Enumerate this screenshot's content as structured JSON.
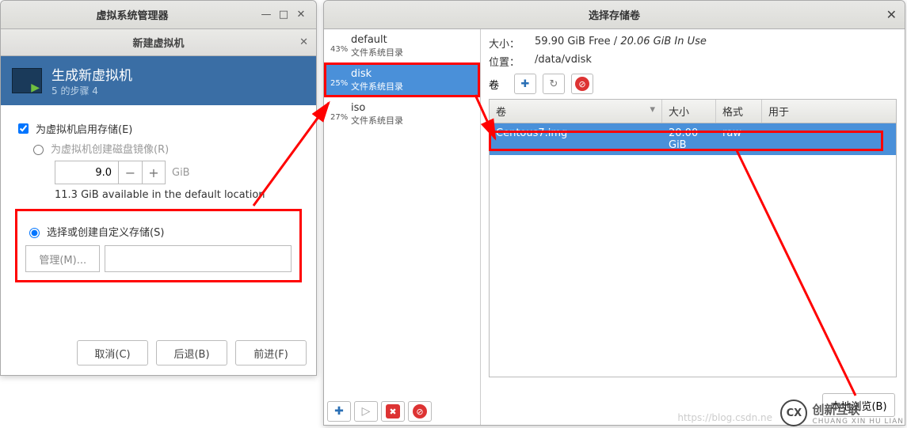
{
  "left_window": {
    "title": "虚拟系统管理器",
    "sub_title": "新建虚拟机",
    "banner_title": "生成新虚拟机",
    "banner_step": "5 的步骤 4",
    "enable_storage": "为虚拟机启用存储(E)",
    "create_disk": "为虚拟机创建磁盘镜像(R)",
    "disk_size_value": "9.0",
    "disk_size_unit": "GiB",
    "available_text": "11.3 GiB available in the default location",
    "custom_storage": "选择或创建自定义存储(S)",
    "manage_btn": "管理(M)...",
    "custom_path": "",
    "btn_cancel": "取消(C)",
    "btn_back": "后退(B)",
    "btn_forward": "前进(F)"
  },
  "right_window": {
    "title": "选择存储卷",
    "pools": [
      {
        "pct": "43%",
        "name": "default",
        "type": "文件系统目录",
        "selected": false
      },
      {
        "pct": "25%",
        "name": "disk",
        "type": "文件系统目录",
        "selected": true
      },
      {
        "pct": "27%",
        "name": "iso",
        "type": "文件系统目录",
        "selected": false
      }
    ],
    "size_label": "大小：",
    "size_value": "59.90 GiB Free / 20.06 GiB In Use",
    "location_label": "位置：",
    "location_value": "/data/vdisk",
    "vol_label": "卷",
    "columns": {
      "vol": "卷",
      "size": "大小",
      "format": "格式",
      "used": "用于"
    },
    "volumes": [
      {
        "name": "Centous7.img",
        "size": "20.00 GiB",
        "format": "raw",
        "used": ""
      }
    ],
    "browse_btn": "本地浏览(B)"
  },
  "watermark": {
    "brand1": "创新互联",
    "brand2": "CHUANG XIN HU LIAN",
    "url": "https://blog.csdn.ne"
  }
}
